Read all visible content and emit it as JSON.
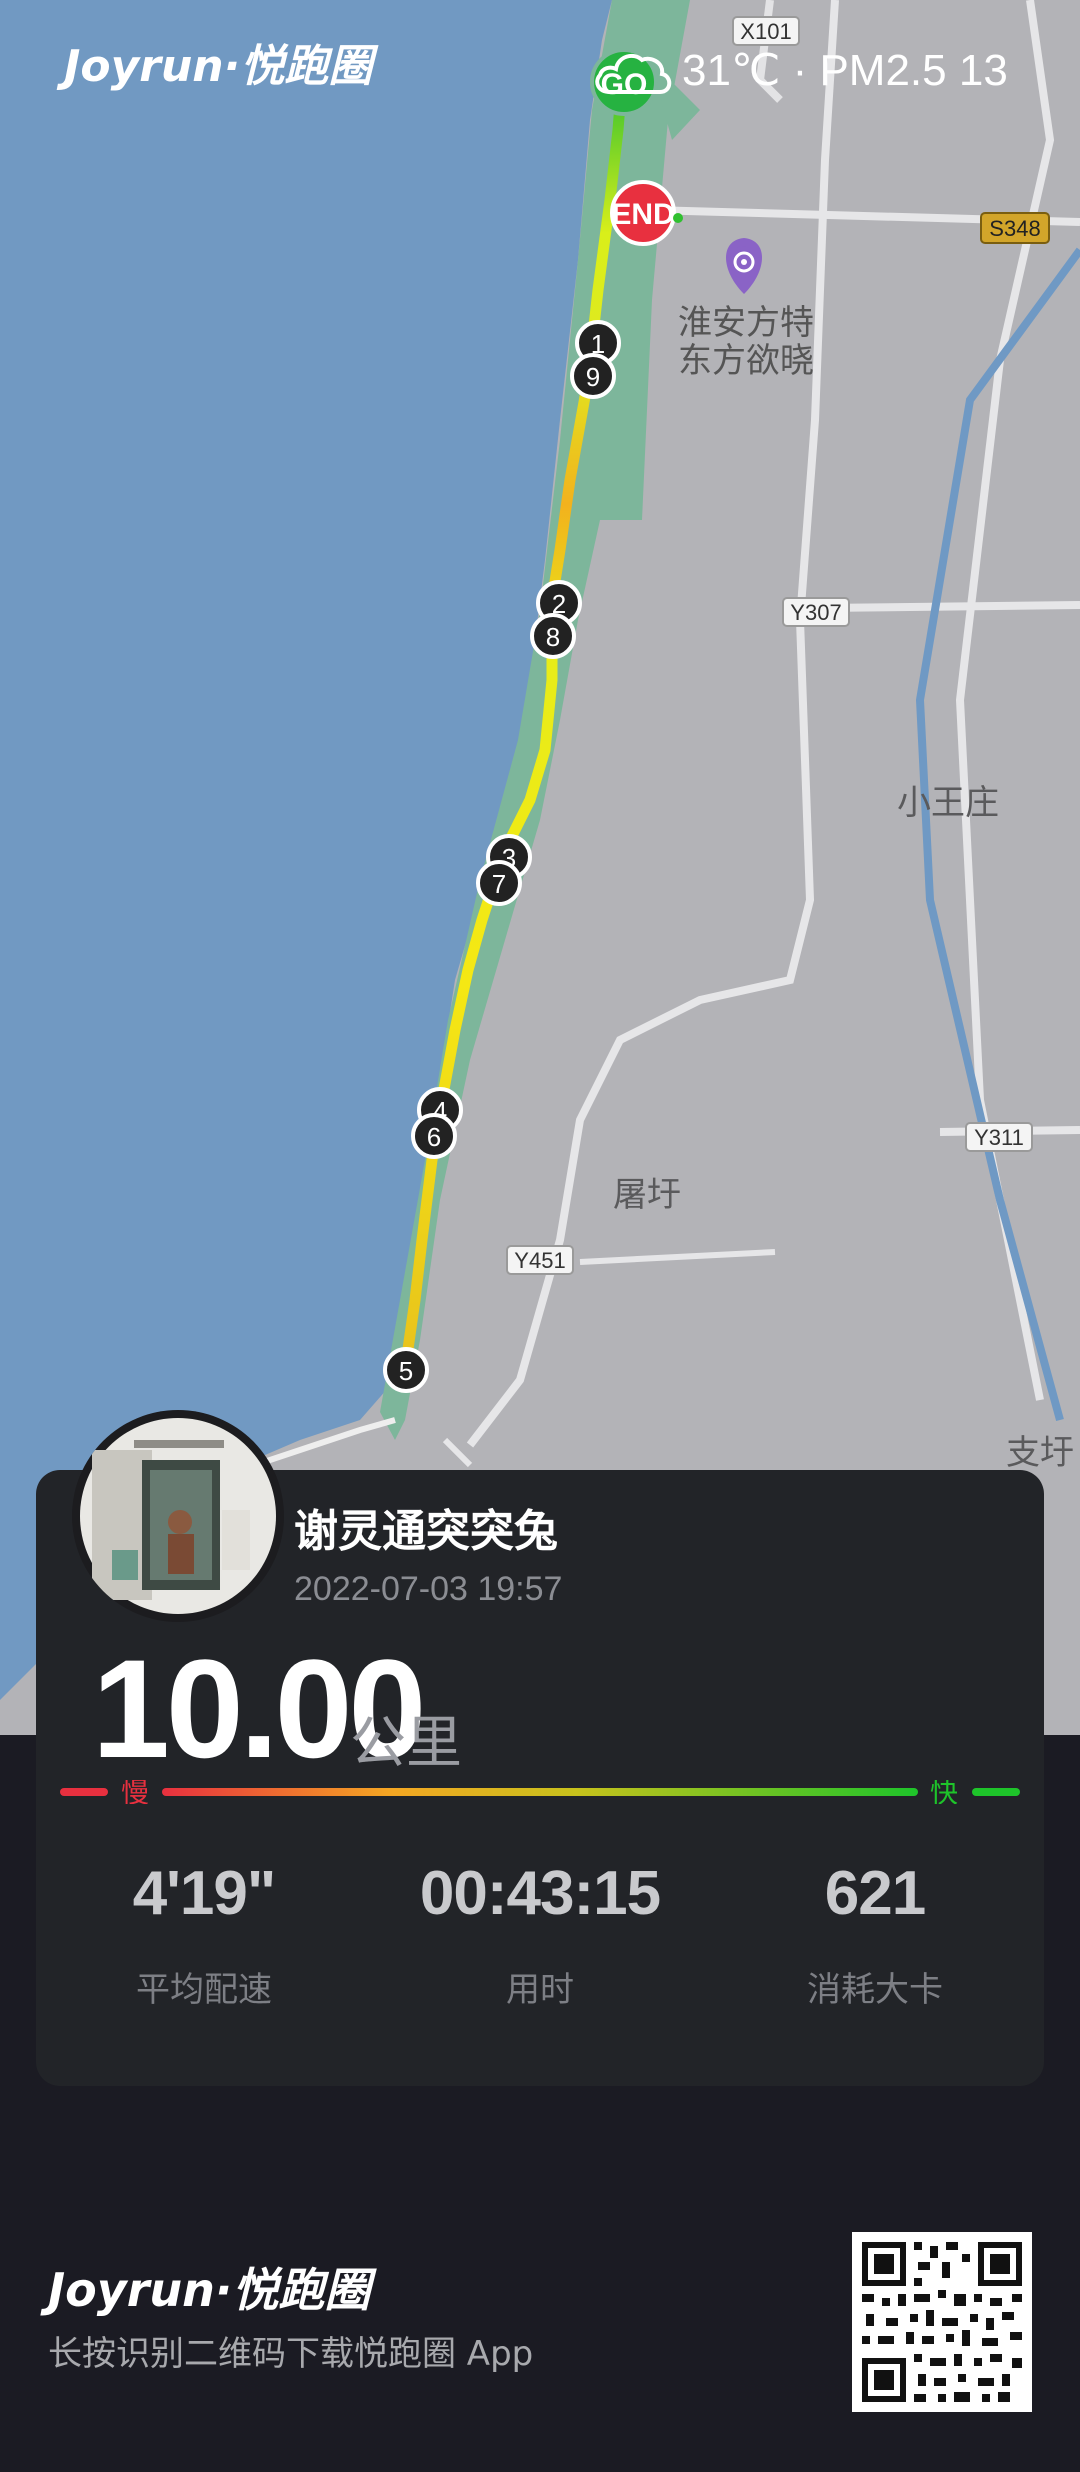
{
  "brand": {
    "name": "Joyrun·悦跑圈"
  },
  "weather": {
    "icon": "cloud-icon",
    "text": "31℃ · PM2.5 13"
  },
  "map": {
    "start_label": "GO",
    "end_label": "END",
    "poi_name_line1": "淮安方特",
    "poi_name_line2": "东方欲晓",
    "place_labels": [
      "小王庄",
      "屠圩",
      "支圩"
    ],
    "road_labels": [
      "X101",
      "S348",
      "Y307",
      "Y311",
      "Y451"
    ],
    "km_markers": [
      "1",
      "9",
      "2",
      "8",
      "3",
      "7",
      "4",
      "6",
      "5"
    ]
  },
  "run": {
    "user_name": "谢灵通突突兔",
    "date": "2022-07-03 19:57",
    "distance": "10.00",
    "distance_unit": "公里",
    "pace_slow_label": "慢",
    "pace_fast_label": "快",
    "stats": [
      {
        "value": "4'19\"",
        "label": "平均配速"
      },
      {
        "value": "00:43:15",
        "label": "用时"
      },
      {
        "value": "621",
        "label": "消耗大卡"
      }
    ]
  },
  "footer": {
    "download_text": "长按识别二维码下载悦跑圈 App"
  },
  "colors": {
    "sea": "#7199c2",
    "land": "#b3b3b7",
    "park": "#7db69b",
    "slow": "#e8303f",
    "fast": "#1ec42a",
    "card": "#222428"
  }
}
